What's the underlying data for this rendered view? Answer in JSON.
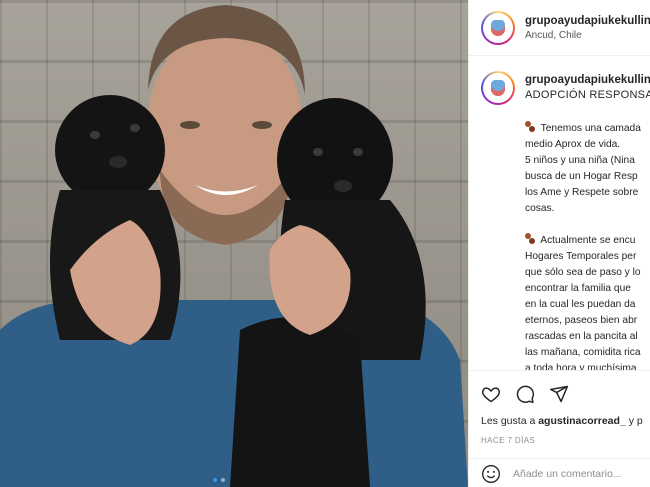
{
  "post": {
    "username": "grupoayudapiukekullin",
    "location": "Ancud, Chile",
    "caption_title": "ADOPCIÓN RESPONSABL",
    "paragraph1": [
      "Tenemos una camada",
      "medio Aprox de vida.",
      "5 niños y una niña (Nina",
      "busca de un Hogar Resp",
      "los Ame y Respete sobre",
      "cosas."
    ],
    "paragraph2": [
      "Actualmente se encu",
      "Hogares Temporales per",
      "que sólo sea de paso y lo",
      "encontrar la familia que",
      "en la cual les puedan da",
      "eternos, paseos bien abr",
      "rascadas en la pancita al",
      "las mañana, comidita rica",
      "a toda hora y muchísima"
    ],
    "likes_prefix": "Les gusta a",
    "likes_user": "agustinacorread_",
    "likes_suffix": "y p",
    "time": "HACE 7 DÍAS",
    "comment_placeholder": "Añade un comentario..."
  },
  "colors": {
    "accent": "#3897f0",
    "text": "#262626",
    "muted": "#8e8e8e"
  },
  "icons": [
    "heart-icon",
    "comment-icon",
    "share-icon",
    "emoji-icon",
    "paw-emoji"
  ]
}
